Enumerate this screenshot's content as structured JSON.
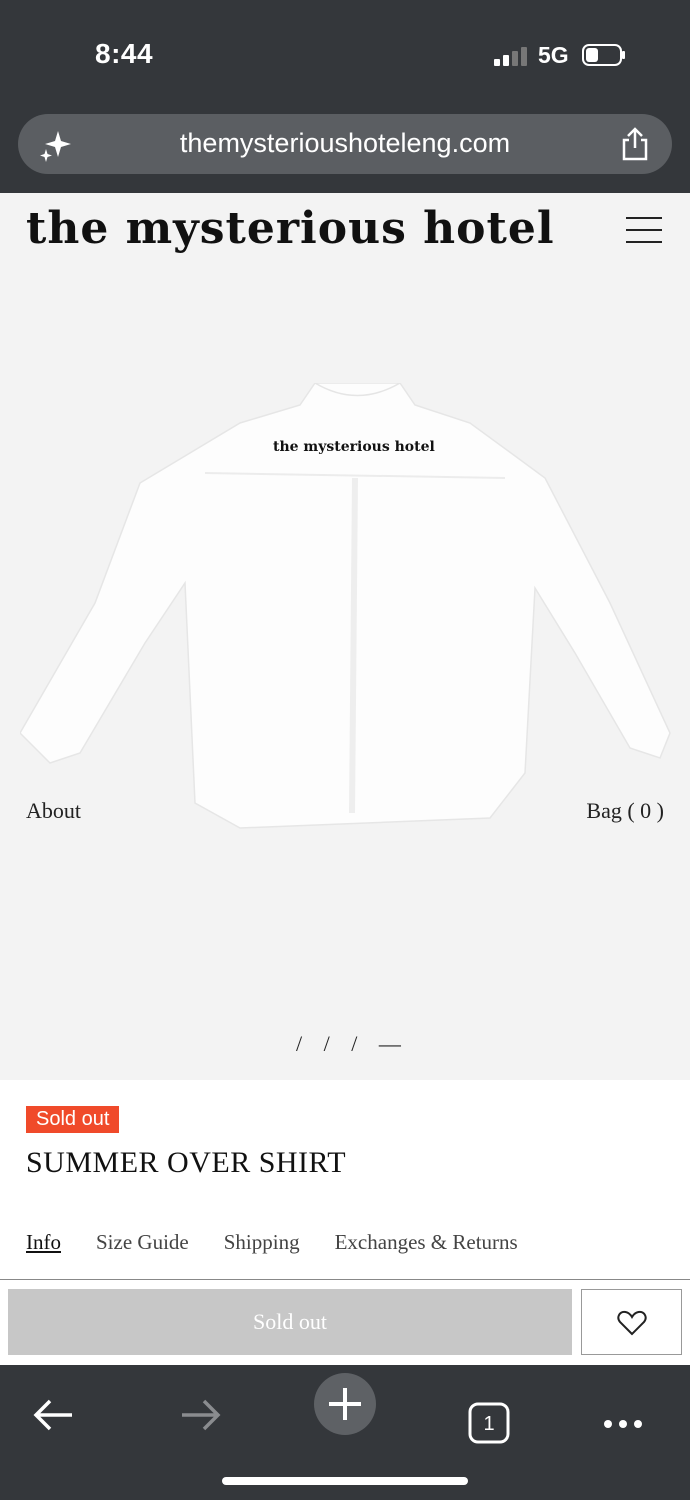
{
  "status": {
    "time": "8:44",
    "network": "5G"
  },
  "browser": {
    "url": "themysterioushoteleng.com",
    "tab_count": "1"
  },
  "site": {
    "logo": "the mysterious hotel"
  },
  "nav": {
    "about": "About",
    "bag": "Bag ( 0 )"
  },
  "product": {
    "shirt_print": "the mysterious hotel",
    "carousel": "/ / / —",
    "badge": "Sold out",
    "name": "SUMMER OVER SHIRT",
    "tabs": [
      "Info",
      "Size Guide",
      "Shipping",
      "Exchanges & Returns"
    ],
    "button": "Sold out"
  },
  "icons": [
    "sparkle-icon",
    "share-icon",
    "menu-icon",
    "heart-icon",
    "back-arrow-icon",
    "forward-arrow-icon",
    "new-tab-icon",
    "tabs-icon",
    "more-icon"
  ]
}
